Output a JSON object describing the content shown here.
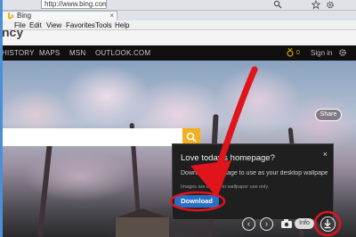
{
  "browser": {
    "address": "http://www.bing.com/",
    "tab_title": "Bing",
    "tab_close": "×",
    "menu": [
      "File",
      "Edit",
      "View",
      "Favorites",
      "Tools",
      "Help"
    ]
  },
  "page": {
    "cut_title": "ncy",
    "nav": [
      "HISTORY",
      "MAPS",
      "MSN",
      "OUTLOOK.COM"
    ],
    "rewards_count": "0",
    "signin": "Sign in",
    "share": "Share"
  },
  "popup": {
    "title": "Love today's homepage?",
    "close": "×",
    "body": "Download the image to use as your desktop wallpaper.",
    "note": "Images are limited to wallpaper use only.",
    "download": "Download"
  },
  "controls": {
    "prev": "‹",
    "next": "›",
    "info": "Info"
  },
  "colors": {
    "search_button": "#f2b01e",
    "download_button": "#2a6fc4",
    "annotation": "#e0141b"
  }
}
